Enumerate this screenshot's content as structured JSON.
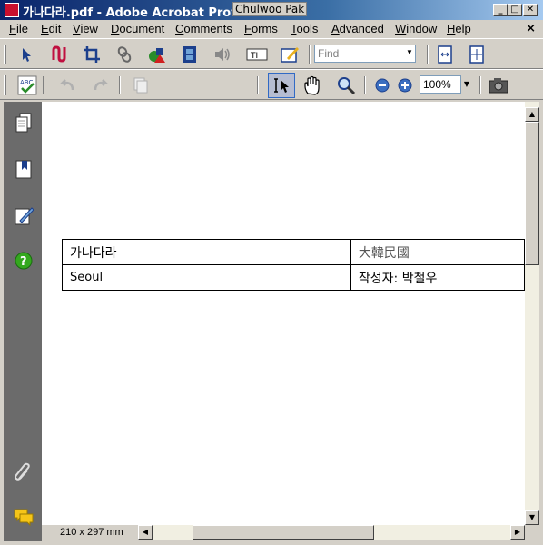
{
  "window": {
    "title": "가나다라.pdf - Adobe Acrobat Professional",
    "author_overlay": "Chulwoo Pak",
    "minimize": "_",
    "maximize": "□",
    "close": "✕"
  },
  "menu": {
    "items": [
      {
        "label": "File"
      },
      {
        "label": "Edit"
      },
      {
        "label": "View"
      },
      {
        "label": "Document"
      },
      {
        "label": "Comments"
      },
      {
        "label": "Forms"
      },
      {
        "label": "Tools"
      },
      {
        "label": "Advanced"
      },
      {
        "label": "Window"
      },
      {
        "label": "Help"
      }
    ],
    "doc_close": "×"
  },
  "toolbar1": {
    "find_placeholder": "Find"
  },
  "toolbar2": {
    "zoom_value": "100%"
  },
  "document": {
    "table": [
      [
        "가나다라",
        "大韓民國"
      ],
      [
        "Seoul",
        "작성자:  박철우"
      ]
    ]
  },
  "status": {
    "page_size": "210 x 297 mm"
  },
  "colors": {
    "titlebar_start": "#0a246a",
    "nav_pane": "#6b6b6b",
    "chrome": "#d4d0c8"
  }
}
